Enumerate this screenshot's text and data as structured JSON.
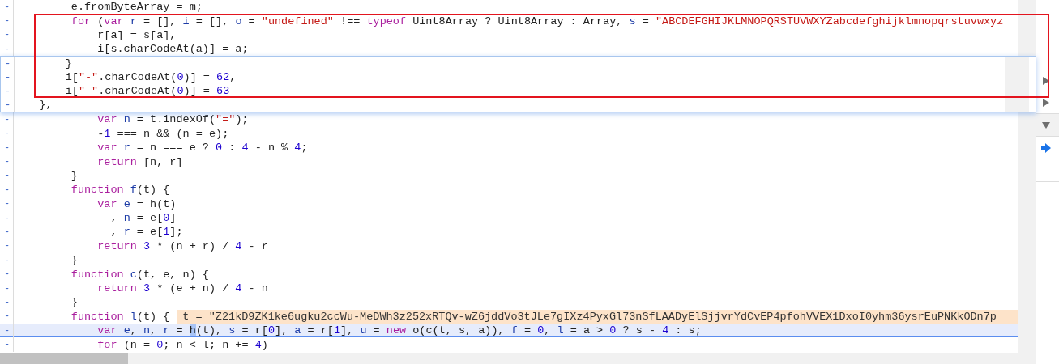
{
  "editor": {
    "lines_top": [
      {
        "marker": "-",
        "tokens": [
          {
            "text": "        e.fromByteArray = m;",
            "kind": "plain"
          }
        ]
      },
      {
        "marker": "-",
        "tokens": [
          {
            "text": "        for",
            "kind": "keyword"
          },
          {
            "text": " (",
            "kind": "plain"
          },
          {
            "text": "var",
            "kind": "keyword"
          },
          {
            "text": " r",
            "kind": "variable"
          },
          {
            "text": " = [], ",
            "kind": "plain"
          },
          {
            "text": "i",
            "kind": "variable"
          },
          {
            "text": " = [], ",
            "kind": "plain"
          },
          {
            "text": "o",
            "kind": "variable"
          },
          {
            "text": " = ",
            "kind": "plain"
          },
          {
            "text": "\"undefined\"",
            "kind": "string"
          },
          {
            "text": " !== ",
            "kind": "plain"
          },
          {
            "text": "typeof",
            "kind": "keyword"
          },
          {
            "text": " Uint8Array ? Uint8Array : Array, ",
            "kind": "plain"
          },
          {
            "text": "s",
            "kind": "variable"
          },
          {
            "text": " = ",
            "kind": "plain"
          },
          {
            "text": "\"ABCDEFGHIJKLMNOPQRSTUVWXYZabcdefghijklmnopqrstuvwxyz",
            "kind": "string"
          }
        ]
      },
      {
        "marker": "-",
        "tokens": [
          {
            "text": "            r[a] = s[a],",
            "kind": "plain"
          }
        ]
      },
      {
        "marker": "-",
        "tokens": [
          {
            "text": "            i[s.charCodeAt(a)] = a;",
            "kind": "plain"
          }
        ]
      }
    ],
    "lines_bottom": [
      {
        "marker": "-",
        "tokens": [
          {
            "text": "            var",
            "kind": "keyword"
          },
          {
            "text": " n",
            "kind": "variable"
          },
          {
            "text": " = t.indexOf(",
            "kind": "plain"
          },
          {
            "text": "\"=\"",
            "kind": "string"
          },
          {
            "text": ");",
            "kind": "plain"
          }
        ]
      },
      {
        "marker": "-",
        "tokens": [
          {
            "text": "            -",
            "kind": "plain"
          },
          {
            "text": "1",
            "kind": "number"
          },
          {
            "text": " === n && (n = e);",
            "kind": "plain"
          }
        ]
      },
      {
        "marker": "-",
        "tokens": [
          {
            "text": "            var",
            "kind": "keyword"
          },
          {
            "text": " r",
            "kind": "variable"
          },
          {
            "text": " = n === e ? ",
            "kind": "plain"
          },
          {
            "text": "0",
            "kind": "number"
          },
          {
            "text": " : ",
            "kind": "plain"
          },
          {
            "text": "4",
            "kind": "number"
          },
          {
            "text": " - n % ",
            "kind": "plain"
          },
          {
            "text": "4",
            "kind": "number"
          },
          {
            "text": ";",
            "kind": "plain"
          }
        ]
      },
      {
        "marker": "-",
        "tokens": [
          {
            "text": "            return",
            "kind": "keyword"
          },
          {
            "text": " [n, r]",
            "kind": "plain"
          }
        ]
      },
      {
        "marker": "-",
        "tokens": [
          {
            "text": "        }",
            "kind": "plain"
          }
        ]
      },
      {
        "marker": "-",
        "tokens": [
          {
            "text": "        function",
            "kind": "keyword"
          },
          {
            "text": " f",
            "kind": "variable"
          },
          {
            "text": "(t) {",
            "kind": "plain"
          }
        ]
      },
      {
        "marker": "-",
        "tokens": [
          {
            "text": "            var",
            "kind": "keyword"
          },
          {
            "text": " e",
            "kind": "variable"
          },
          {
            "text": " = h(t)",
            "kind": "plain"
          }
        ]
      },
      {
        "marker": "-",
        "tokens": [
          {
            "text": "              , ",
            "kind": "plain"
          },
          {
            "text": "n",
            "kind": "variable"
          },
          {
            "text": " = e[",
            "kind": "plain"
          },
          {
            "text": "0",
            "kind": "number"
          },
          {
            "text": "]",
            "kind": "plain"
          }
        ]
      },
      {
        "marker": "-",
        "tokens": [
          {
            "text": "              , ",
            "kind": "plain"
          },
          {
            "text": "r",
            "kind": "variable"
          },
          {
            "text": " = e[",
            "kind": "plain"
          },
          {
            "text": "1",
            "kind": "number"
          },
          {
            "text": "];",
            "kind": "plain"
          }
        ]
      },
      {
        "marker": "-",
        "tokens": [
          {
            "text": "            return",
            "kind": "keyword"
          },
          {
            "text": " 3",
            "kind": "number"
          },
          {
            "text": " * (n + r) / ",
            "kind": "plain"
          },
          {
            "text": "4",
            "kind": "number"
          },
          {
            "text": " - r",
            "kind": "plain"
          }
        ]
      },
      {
        "marker": "-",
        "tokens": [
          {
            "text": "        }",
            "kind": "plain"
          }
        ]
      },
      {
        "marker": "-",
        "tokens": [
          {
            "text": "        function",
            "kind": "keyword"
          },
          {
            "text": " c",
            "kind": "variable"
          },
          {
            "text": "(t, e, n) {",
            "kind": "plain"
          }
        ]
      },
      {
        "marker": "-",
        "tokens": [
          {
            "text": "            return",
            "kind": "keyword"
          },
          {
            "text": " 3",
            "kind": "number"
          },
          {
            "text": " * (e + n) / ",
            "kind": "plain"
          },
          {
            "text": "4",
            "kind": "number"
          },
          {
            "text": " - n",
            "kind": "plain"
          }
        ]
      },
      {
        "marker": "-",
        "tokens": [
          {
            "text": "        }",
            "kind": "plain"
          }
        ]
      },
      {
        "marker": "-",
        "tokens": [
          {
            "text": "        function",
            "kind": "keyword"
          },
          {
            "text": " l",
            "kind": "variable"
          },
          {
            "text": "(t) {",
            "kind": "plain"
          }
        ],
        "inline_value": "t = \"Z21kD9ZK1ke6ugku2ccWu-MeDWh3z252xRTQv-wZ6jddVo3tJLe7gIXz4PyxGl73nSfLAADyElSjjvrYdCvEP4pfohVVEX1DxoI0yhm36ysrEuPNKkODn7p"
      },
      {
        "marker": "-",
        "current": true,
        "tokens": [
          {
            "text": "            var",
            "kind": "keyword"
          },
          {
            "text": " e",
            "kind": "variable"
          },
          {
            "text": ", ",
            "kind": "plain"
          },
          {
            "text": "n",
            "kind": "variable"
          },
          {
            "text": ", ",
            "kind": "plain"
          },
          {
            "text": "r",
            "kind": "variable"
          },
          {
            "text": " = ",
            "kind": "plain"
          },
          {
            "text": "h",
            "kind": "selection"
          },
          {
            "text": "(t), ",
            "kind": "plain"
          },
          {
            "text": "s",
            "kind": "variable"
          },
          {
            "text": " = r[",
            "kind": "plain"
          },
          {
            "text": "0",
            "kind": "number"
          },
          {
            "text": "], ",
            "kind": "plain"
          },
          {
            "text": "a",
            "kind": "variable"
          },
          {
            "text": " = r[",
            "kind": "plain"
          },
          {
            "text": "1",
            "kind": "number"
          },
          {
            "text": "], ",
            "kind": "plain"
          },
          {
            "text": "u",
            "kind": "variable"
          },
          {
            "text": " = ",
            "kind": "plain"
          },
          {
            "text": "new",
            "kind": "keyword"
          },
          {
            "text": " o(c(t, s, a)), ",
            "kind": "plain"
          },
          {
            "text": "f",
            "kind": "variable"
          },
          {
            "text": " = ",
            "kind": "plain"
          },
          {
            "text": "0",
            "kind": "number"
          },
          {
            "text": ", ",
            "kind": "plain"
          },
          {
            "text": "l",
            "kind": "variable"
          },
          {
            "text": " = a > ",
            "kind": "plain"
          },
          {
            "text": "0",
            "kind": "number"
          },
          {
            "text": " ? s - ",
            "kind": "plain"
          },
          {
            "text": "4",
            "kind": "number"
          },
          {
            "text": " : s;",
            "kind": "plain"
          }
        ]
      },
      {
        "marker": "-",
        "tokens": [
          {
            "text": "            for",
            "kind": "keyword"
          },
          {
            "text": " (n = ",
            "kind": "plain"
          },
          {
            "text": "0",
            "kind": "number"
          },
          {
            "text": "; n < l; n += ",
            "kind": "plain"
          },
          {
            "text": "4",
            "kind": "number"
          },
          {
            "text": ")",
            "kind": "plain"
          }
        ]
      }
    ]
  },
  "popup": {
    "lines": [
      {
        "marker": "-",
        "tokens": [
          {
            "text": "       }",
            "kind": "plain"
          }
        ]
      },
      {
        "marker": "-",
        "tokens": [
          {
            "text": "       i[",
            "kind": "plain"
          },
          {
            "text": "\"-\"",
            "kind": "string"
          },
          {
            "text": ".charCodeAt(",
            "kind": "plain"
          },
          {
            "text": "0",
            "kind": "number"
          },
          {
            "text": ")] = ",
            "kind": "plain"
          },
          {
            "text": "62",
            "kind": "number"
          },
          {
            "text": ",",
            "kind": "plain"
          }
        ]
      },
      {
        "marker": "-",
        "tokens": [
          {
            "text": "       i[",
            "kind": "plain"
          },
          {
            "text": "\"_\"",
            "kind": "string"
          },
          {
            "text": ".charCodeAt(",
            "kind": "plain"
          },
          {
            "text": "0",
            "kind": "number"
          },
          {
            "text": ")] = ",
            "kind": "plain"
          },
          {
            "text": "63",
            "kind": "number"
          }
        ]
      },
      {
        "marker": "-",
        "tokens": [
          {
            "text": "   },",
            "kind": "plain"
          }
        ]
      }
    ]
  },
  "side_panel": {
    "items": [
      {
        "kind": "collapsed"
      },
      {
        "kind": "collapsed"
      },
      {
        "kind": "expanded"
      },
      {
        "kind": "current"
      },
      {
        "kind": "empty"
      },
      {
        "kind": "empty"
      }
    ]
  }
}
